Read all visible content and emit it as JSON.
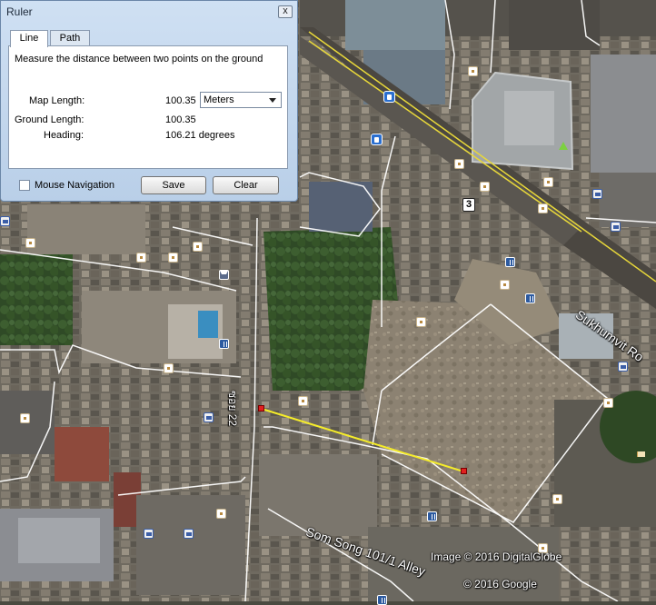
{
  "dialog": {
    "title": "Ruler",
    "close_glyph": "x",
    "tabs": [
      {
        "label": "Line",
        "active": true
      },
      {
        "label": "Path",
        "active": false
      }
    ],
    "instruction": "Measure the distance between two points on the ground",
    "map_length_label": "Map Length:",
    "map_length_value": "100.35",
    "unit_selected": "Meters",
    "ground_length_label": "Ground Length:",
    "ground_length_value": "100.35",
    "heading_label": "Heading:",
    "heading_value": "106.21 degrees",
    "mouse_nav_label": "Mouse Navigation",
    "mouse_nav_checked": false,
    "save_label": "Save",
    "clear_label": "Clear"
  },
  "map": {
    "street_labels": {
      "sukhumvit": "Sukhumvit Ro",
      "som_song": "Som Song 101/1 Alley",
      "soi22": "ซอย 22"
    },
    "route_shield": "3",
    "imagery_credit": "Image © 2016 DigitalGlobe",
    "copyright": "© 2016 Google",
    "road_color": "#ffffff",
    "highway_color": "#e8d83a",
    "ruler_line_color": "#f5ec2a",
    "ruler_point_color": "#e02020",
    "icons": [
      "transit-icon",
      "poi-icon",
      "restaurant-icon",
      "bar-icon",
      "flag-icon",
      "park-icon"
    ]
  }
}
